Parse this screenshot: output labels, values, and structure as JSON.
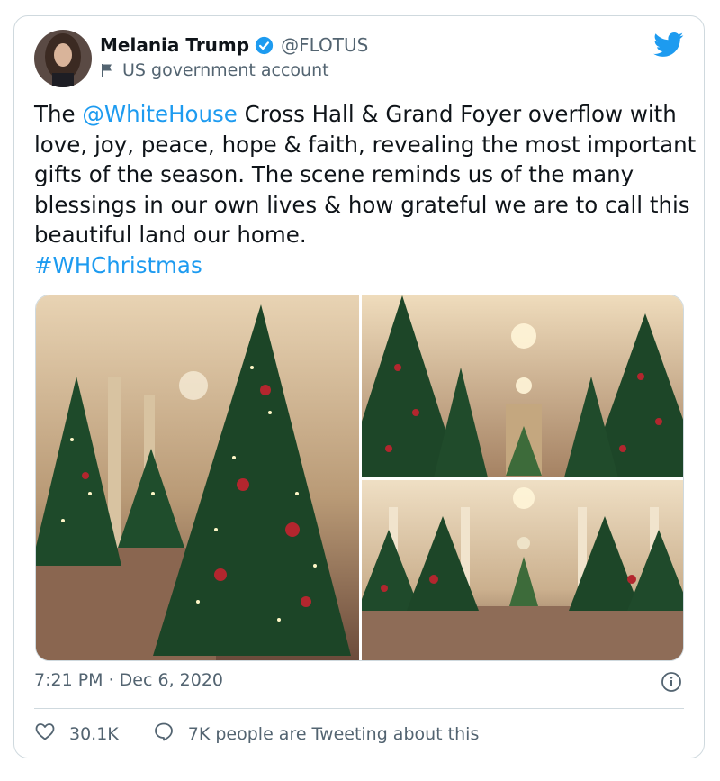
{
  "author": {
    "name": "Melania Trump",
    "handle": "@FLOTUS",
    "label": "US government account"
  },
  "tweet": {
    "prefix": "The ",
    "mention": "@WhiteHouse",
    "body": " Cross Hall & Grand Foyer overflow with love, joy, peace, hope & faith, revealing the most important gifts of the season. The scene reminds us of the many blessings in our own lives & how grateful we are to call this beautiful land our home.",
    "hashtag": "#WHChristmas"
  },
  "timestamp": "7:21 PM · Dec 6, 2020",
  "stats": {
    "likes": "30.1K",
    "tweeting": "7K people are Tweeting about this"
  },
  "icons": {
    "verified": "verified-badge-icon",
    "gov": "flag-icon",
    "brand": "twitter-bird-icon",
    "info": "info-icon",
    "like": "heart-icon",
    "reply": "reply-bubble-icon"
  },
  "colors": {
    "accent": "#1d9bf0",
    "text": "#0f1419",
    "secondary": "#536471",
    "border": "#cfd9de"
  }
}
